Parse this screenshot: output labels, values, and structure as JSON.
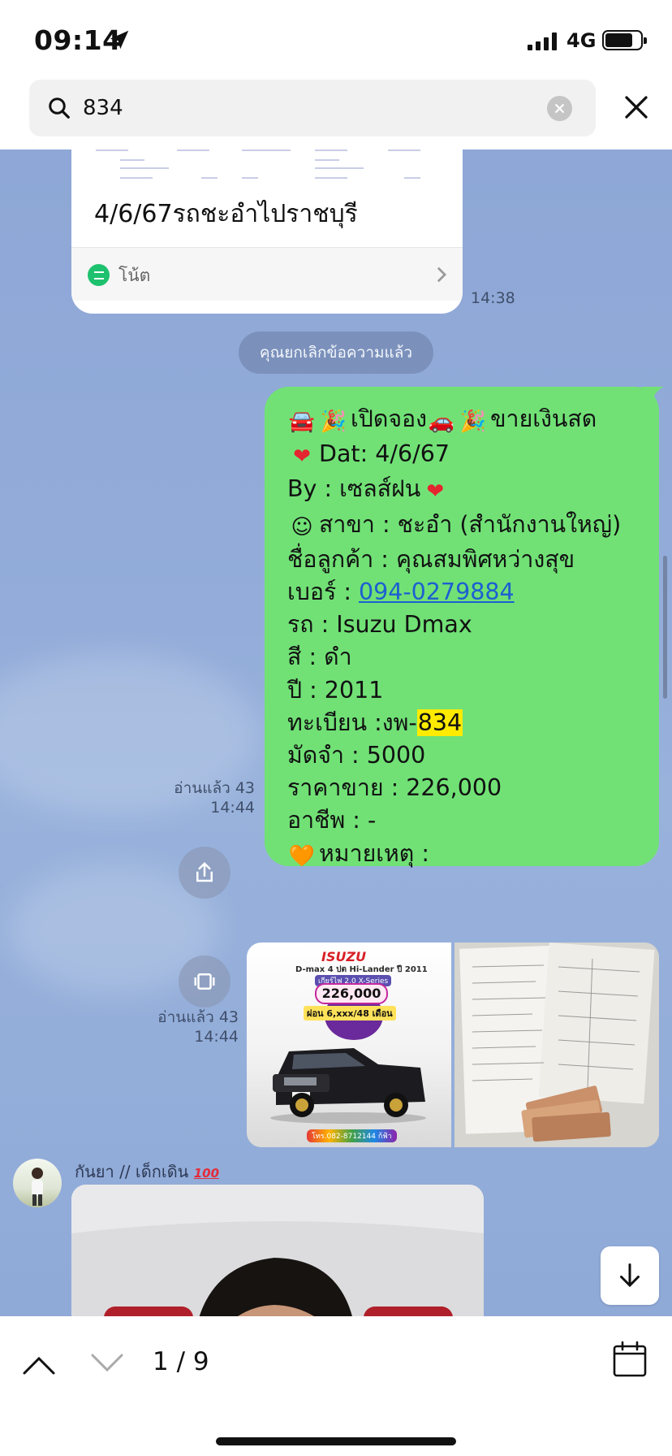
{
  "status_bar": {
    "time": "09:14",
    "network": "4G",
    "icons": [
      "location-arrow-icon",
      "signal-icon",
      "battery-icon"
    ]
  },
  "search": {
    "query": "834",
    "placeholder": ""
  },
  "messages": {
    "note_card": {
      "title": "4/6/67รถชะอำไปราชบุรี",
      "label": "โน้ต",
      "time": "14:38"
    },
    "system_notice": "คุณยกเลิกข้อความแล้ว",
    "sent_text": {
      "lines": [
        {
          "emoji": "🚘",
          "emoji2": "🎉",
          "text": "เปิดจอง",
          "emoji3": "🚗",
          "emoji4": "🎉",
          "text2": "ขายเงินสด"
        },
        {
          "emoji": "❤",
          "text": "Dat: 4/6/67"
        },
        {
          "text": "By : เซลส์ฝน",
          "emoji": "❤"
        },
        {
          "emoji": "☺",
          "text": "สาขา : ชะอำ (สำนักงานใหญ่)"
        },
        {
          "text": "ชื่อลูกค้า : คุณสมพิศหว่างสุข"
        },
        {
          "label": "เบอร์ : ",
          "phone": "094-0279884"
        },
        {
          "text": "รถ : Isuzu Dmax"
        },
        {
          "text": "สี : ดำ"
        },
        {
          "text": "ปี : 2011"
        },
        {
          "label": "ทะเบียน :งพ-",
          "highlight": "834"
        },
        {
          "text": "มัดจำ : 5000"
        },
        {
          "text": "ราคาขาย : 226,000"
        },
        {
          "text": "อาชีพ : -"
        },
        {
          "emoji": "🧡",
          "text": "หมายเหตุ :"
        }
      ],
      "read_status": "อ่านแล้ว 43",
      "time": "14:44"
    },
    "sent_images": {
      "ad": {
        "brand": "ISUZU",
        "model": "D-max 4 ปต Hi-Lander ปี 2011",
        "promo": "เกียร์ไฟ 2.0 X-Series",
        "price": "226,000",
        "installment": "ผ่อน 6,xxx/48 เดือน",
        "contact": "โทร.082-8712144 ก้ฟ้า"
      },
      "read_status": "อ่านแล้ว 43",
      "time": "14:44"
    },
    "incoming": {
      "sender": "กันยา // เด็กเดิน",
      "sender_emoji": "100"
    }
  },
  "bottom_bar": {
    "page_counter": "1 / 9"
  },
  "colors": {
    "chat_background": "#8ea7d6",
    "sent_bubble": "#71e176",
    "highlight": "#ffeb00",
    "link": "#1d5fd1"
  }
}
